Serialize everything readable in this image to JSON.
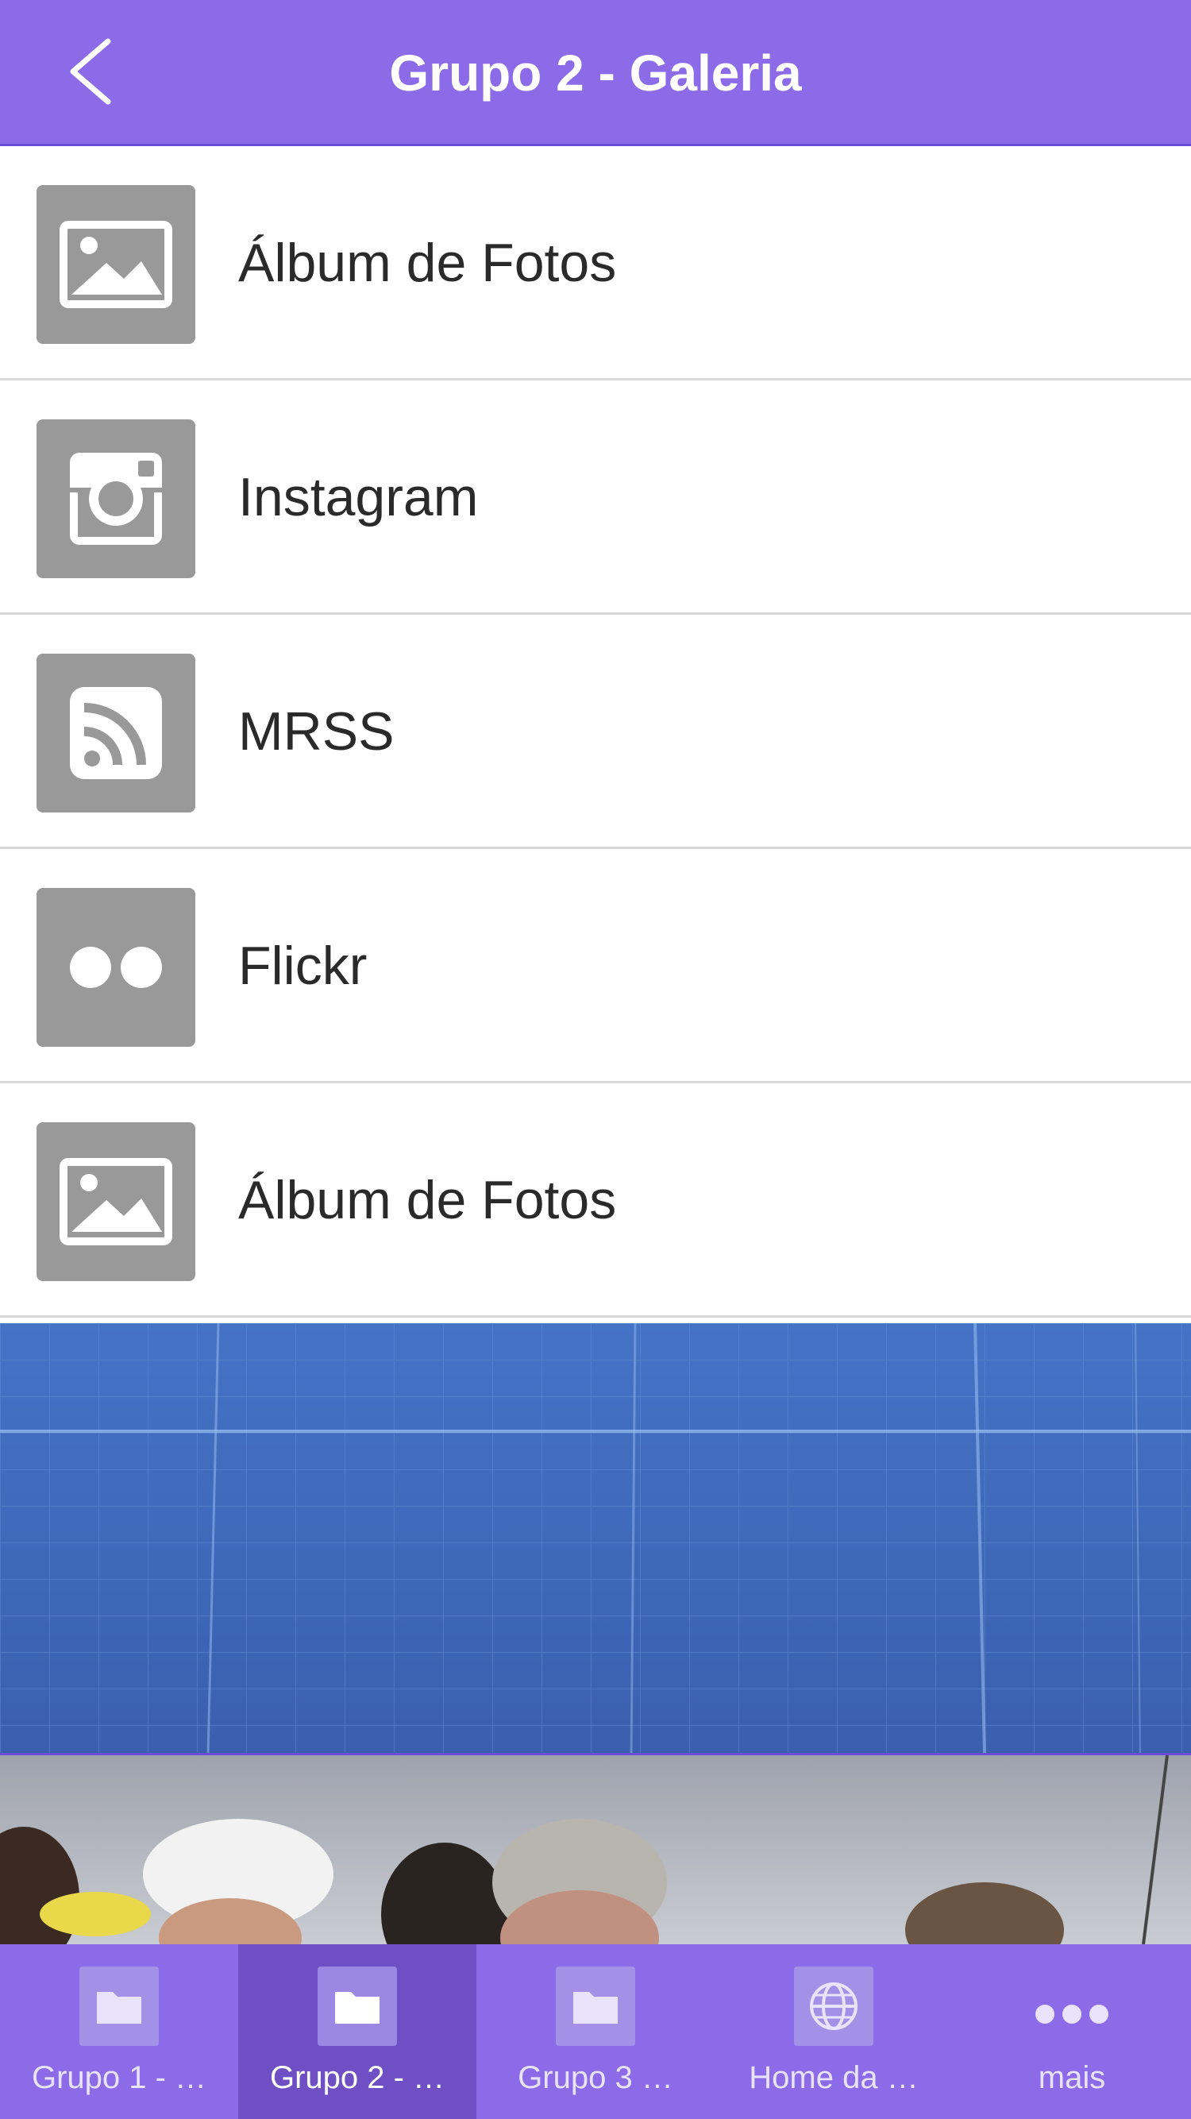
{
  "header": {
    "title": "Grupo 2 - Galeria"
  },
  "list": {
    "items": [
      {
        "label": "Álbum de Fotos",
        "icon": "image-icon"
      },
      {
        "label": "Instagram",
        "icon": "instagram-icon"
      },
      {
        "label": "MRSS",
        "icon": "rss-icon"
      },
      {
        "label": "Flickr",
        "icon": "flickr-icon"
      },
      {
        "label": "Álbum de Fotos",
        "icon": "image-icon"
      }
    ]
  },
  "tabbar": {
    "tabs": [
      {
        "label": "Grupo 1 - …",
        "icon": "folder-icon",
        "active": false
      },
      {
        "label": "Grupo 2 - …",
        "icon": "folder-icon",
        "active": true
      },
      {
        "label": "Grupo 3 …",
        "icon": "folder-icon",
        "active": false
      },
      {
        "label": "Home da …",
        "icon": "globe-icon",
        "active": false
      },
      {
        "label": "mais",
        "icon": "more-icon",
        "active": false
      }
    ]
  },
  "colors": {
    "accent": "#8b6be8",
    "active_tab": "#6f4fc4",
    "icon_tile": "#999999",
    "banner": "#3f66b9"
  }
}
